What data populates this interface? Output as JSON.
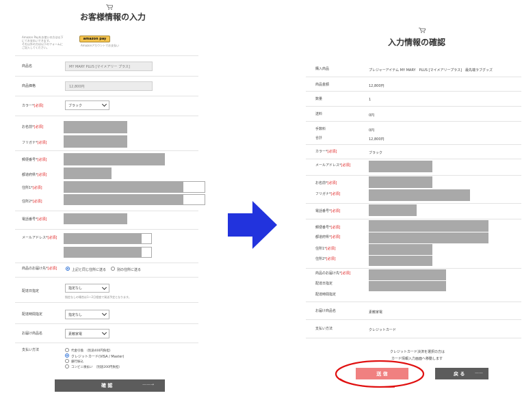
{
  "left": {
    "title": "お客様情報の入力",
    "amazon_note": [
      "Amazon Payをお使いの方は以下",
      "にてお支払いできます。",
      "それ以外の方は以下のフォームに",
      "ご記入してください。"
    ],
    "amazon_button": "amazon pay",
    "amazon_sub": "Amazonアカウントでお支払い",
    "fields": {
      "product_name": {
        "label": "商品名",
        "value": "MY MARY PLUS [マイメアリー プラス]"
      },
      "price": {
        "label": "商品価格",
        "value": "12,800円"
      },
      "color": {
        "label": "カラー*",
        "req": "[必須]",
        "value": "ブラック"
      },
      "name": {
        "label": "お名前*",
        "req": "[必須]"
      },
      "kana": {
        "label": "フリガナ*",
        "req": "[必須]"
      },
      "zip": {
        "label": "郵便番号*",
        "req": "[必須]"
      },
      "pref": {
        "label": "都道府県*",
        "req": "[必須]"
      },
      "addr1": {
        "label": "住所1*",
        "req": "[必須]"
      },
      "addr2": {
        "label": "住所2*",
        "req": "[必須]"
      },
      "tel": {
        "label": "電話番号*",
        "req": "[必須]"
      },
      "email": {
        "label": "メールアドレス*",
        "req": "[必須]"
      },
      "dest": {
        "label": "商品のお届け先*",
        "req": "[必須]",
        "opt1": "上記と同じ住所に送る",
        "opt2": "別の住所に送る"
      },
      "date": {
        "label": "配達日指定",
        "value": "指定なし",
        "note": "指定なしの場合は1〜2日程度で発送予定となります。"
      },
      "time": {
        "label": "配達時間指定",
        "value": "指定なし"
      },
      "item": {
        "label": "お届け商品名",
        "value": "素敵家電"
      },
      "payment": {
        "label": "支払い方法",
        "options": [
          "代金引換　（別途400円負担）",
          "クレジットカード(VISA / Master)",
          "銀行振込",
          "コンビニ後払い　（別途200円負担）"
        ]
      }
    },
    "confirm_button": "確 認",
    "confirm_arrow": "——→"
  },
  "right": {
    "title": "入力情報の確認",
    "rows": {
      "item": {
        "label": "購入商品",
        "value": "プレジャーアイテム MY MARY　PLUS [マイメアリープラス]　最先端ラブグッズ"
      },
      "amount": {
        "label": "商品金額",
        "value": "12,800円"
      },
      "qty": {
        "label": "数量",
        "value": "1"
      },
      "shipping": {
        "label": "送料",
        "value": "0円"
      },
      "fee": {
        "label": "手数料",
        "value": "0円"
      },
      "total": {
        "label": "合計",
        "value": "12,800円"
      },
      "color": {
        "label": "カラー*",
        "req": "[必須]",
        "value": "ブラック"
      },
      "email": {
        "label": "メールアドレス*",
        "req": "[必須]"
      },
      "name": {
        "label": "お名前*",
        "req": "[必須]"
      },
      "kana": {
        "label": "フリガナ*",
        "req": "[必須]"
      },
      "tel": {
        "label": "電話番号*",
        "req": "[必須]"
      },
      "zip": {
        "label": "郵便番号*",
        "req": "[必須]"
      },
      "pref": {
        "label": "都道府県*",
        "req": "[必須]"
      },
      "addr1": {
        "label": "住所1*",
        "req": "[必須]"
      },
      "addr2": {
        "label": "住所2*",
        "req": "[必須]"
      },
      "dest": {
        "label": "商品のお届け先*",
        "req": "[必須]"
      },
      "date": {
        "label": "配達日指定"
      },
      "time": {
        "label": "配達時間指定"
      },
      "itemname": {
        "label": "お届け商品名",
        "value": "素敵家電"
      },
      "payment": {
        "label": "支払い方法",
        "value": "クレジットカード"
      }
    },
    "notice_line1": "クレジットカード決済を選択の方は",
    "notice_line2": "カード情報入力画面へ移動します",
    "send_button": "送 信",
    "back_button": "戻 る",
    "back_arrow": "——"
  },
  "colors": {
    "required": "#e02020",
    "arrow": "#2233dd",
    "send": "#f08080",
    "circle": "#e01010",
    "dark_button": "#5c5c5c",
    "masked": "#a9a9a9"
  }
}
